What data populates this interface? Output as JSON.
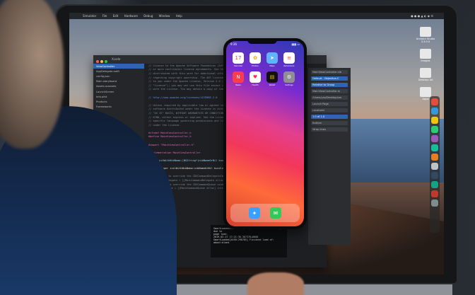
{
  "mac_menubar": {
    "items": [
      "Simulator",
      "File",
      "Edit",
      "Hardware",
      "Debug",
      "Window",
      "Help"
    ]
  },
  "xcode": {
    "title": "Xcode",
    "navigator_items": [
      "ViewController",
      "AppDelegate.swift",
      "config.json",
      "Main.storyboard",
      "Assets.xcassets",
      "LaunchScreen",
      "Info.plist",
      "Products",
      "Frameworks"
    ],
    "code_lines": [
      "// License to the Apache Software Foundation (ASF) under one",
      "// or more contributor license agreements. See the NOTICE file",
      "// distributed with this work for additional information",
      "// regarding copyright ownership. The ASF licenses this file",
      "// to you under the Apache License, Version 2.0 (the",
      "// \"License\"); you may not use this file except in compliance",
      "// with the License. You may obtain a copy of the License at",
      "",
      "//   http://www.apache.org/licenses/LICENSE-2.0",
      "",
      "// Unless required by applicable law or agreed to in writing,",
      "// software distributed under the License is distributed on an",
      "// \"AS IS\" BASIS, WITHOUT WARRANTIES OR CONDITIONS OF ANY",
      "// KIND, either express or implied. See the License for the",
      "// specific language governing permissions and limitations",
      "// under the License.",
      "",
      "#ifndef MainViewController_h",
      "#define MainViewController_h",
      "",
      "#import \"MainViewController.h\"",
      "",
      "@implementation MainViewController",
      "",
      "- (id)initWithNibName:(NSString*)nibNameOrNil bundle:(NSBundle*)nibBundleOrNil",
      "{",
      "    self = [super initWithNibName:nibNameOrNil bundle:nibBundleOrNil];",
      "    if (self) {",
      "        // Uncomment to override the CDVCommandDelegateImpl used",
      "        // _commandDelegate = [[MainCommandDelegate alloc] initWithViewController:self];",
      "        // Uncomment to override the CDVCommandQueue used",
      "        // _commandQueue = [[MainCommandQueue alloc] initWithViewController:self];",
      "    }",
      "    return self;",
      "}",
      "",
      "@end"
    ],
    "console_lines": [
      "SmartLoadedUnitTest (4857)  iPhone XR - 12.1  Apps due to",
      "page load.",
      "2019-02-17 17:21:36.367378+0000",
      "SmartLoaded[4450:290785] Finished load of:",
      "about:blank"
    ]
  },
  "inspector": {
    "fields": [
      "MainViewController.xib",
      "Default - Objective-C",
      "Relative to Group",
      "MainViewController.m",
      "/Users/yas/Desktop/sm",
      "Launch Page",
      "Localized",
      "1.0 of 1.0",
      "Bottom",
      "Wrap lines"
    ]
  },
  "iphone": {
    "time": "9:36",
    "apps": [
      {
        "label": "Calendar",
        "glyph": "17",
        "color": "#ffffff",
        "fg": "#e53935"
      },
      {
        "label": "Photos",
        "glyph": "✿",
        "color": "#ffffff",
        "fg": "#f4a100"
      },
      {
        "label": "Maps",
        "glyph": "➤",
        "color": "#5fb3ff",
        "fg": "#ffffff"
      },
      {
        "label": "Reminders",
        "glyph": "≡",
        "color": "#ffffff",
        "fg": "#ff3b30"
      },
      {
        "label": "News",
        "glyph": "N",
        "color": "#ff3b4e",
        "fg": "#ffffff"
      },
      {
        "label": "Health",
        "glyph": "♥",
        "color": "#ffffff",
        "fg": "#ff2d55"
      },
      {
        "label": "Wallet",
        "glyph": "▤",
        "color": "#111111",
        "fg": "#f1c40f"
      },
      {
        "label": "Settings",
        "glyph": "⚙",
        "color": "#8e8e93",
        "fg": "#ffffff"
      }
    ],
    "dock": [
      {
        "name": "safari",
        "glyph": "✦",
        "color": "#3aa0ff"
      },
      {
        "name": "messages",
        "glyph": "✉",
        "color": "#34c759"
      }
    ]
  },
  "desktop_icons": [
    "Android Studio 3.3.0.0",
    "Images",
    "Desktop lot",
    "Apps"
  ],
  "colors": {
    "xcode_bg": "#1f2024",
    "selection": "#2e64b4",
    "keyword": "#e06ac7"
  }
}
